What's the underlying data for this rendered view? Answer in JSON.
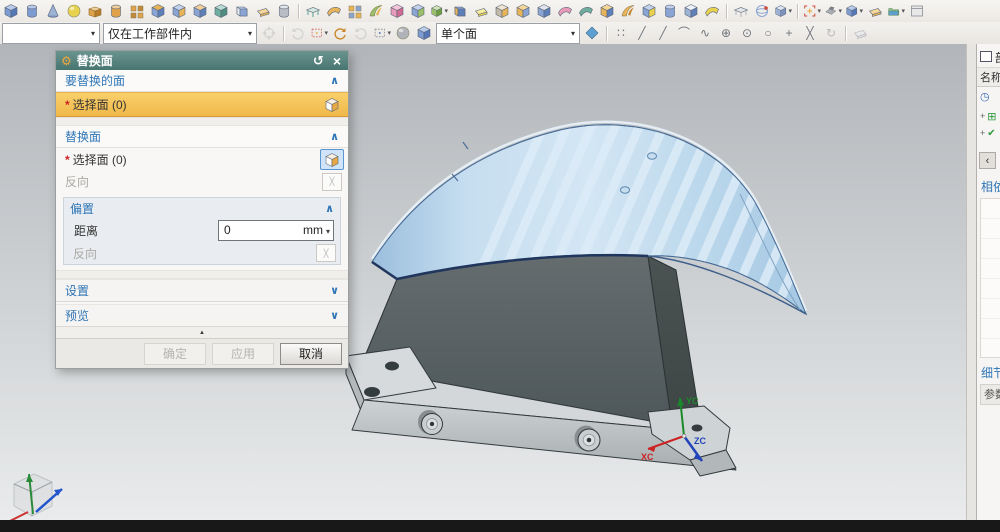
{
  "selection_bar": {
    "type_filter_value": "",
    "scope_value": "仅在工作部件内",
    "face_rule_value": "单个面"
  },
  "dialog": {
    "title": "替换面",
    "sections": {
      "faces_to_replace": "要替换的面",
      "replacement_face": "替换面",
      "offset": "偏置",
      "settings": "设置",
      "preview": "预览"
    },
    "rows": {
      "target_select": {
        "asterisk": "*",
        "label": "选择面 (0)"
      },
      "replacement_select": {
        "asterisk": "*",
        "label": "选择面 (0)"
      },
      "reverse_replacement": "反向",
      "distance_label": "距离",
      "distance_value": "0",
      "distance_unit": "mm",
      "reverse_offset": "反向"
    },
    "buttons": {
      "ok": "确定",
      "apply": "应用",
      "cancel": "取消"
    }
  },
  "part_navigator": {
    "tab_title": "部",
    "column_header": "名称",
    "sections": {
      "dependencies": "相依",
      "details": "细节",
      "details_column": "参数"
    }
  },
  "viewport": {
    "wcs_labels": {
      "xc": "XC",
      "yc": "YC",
      "zc": "ZC"
    }
  },
  "colors": {
    "dialog_header": "#4e7f7a",
    "highlight_row": "#f5c45c",
    "accent_blue": "#2e75b6",
    "sheet_blue": "#c6def0",
    "block_gray": "#596164",
    "viewport_top": "#b2b6ba",
    "viewport_bottom": "#e9ebec"
  },
  "toolbar_row1": [
    {
      "n": "block-icon",
      "g": "cube",
      "c": [
        "#7d9bd0",
        "#5577b5",
        "#b9cbe8"
      ]
    },
    {
      "n": "cylinder-icon",
      "g": "cyl",
      "c": [
        "#7d9bd0",
        "#5577b5",
        "#b9cbe8"
      ]
    },
    {
      "n": "cone-icon",
      "g": "cone",
      "c": [
        "#9db3d6",
        "#7d93bd",
        "#cdd9ec"
      ]
    },
    {
      "n": "sphere-icon",
      "g": "sphere",
      "c": [
        "#e8d24e",
        "#c9ae2e",
        "#f6eca0"
      ]
    },
    {
      "n": "shell-icon",
      "g": "openbox",
      "c": [
        "#e0a24a",
        "#b97c2a",
        "#f0cf9a"
      ]
    },
    {
      "n": "boss-icon",
      "g": "cyl",
      "c": [
        "#e0a24a",
        "#b97c2a",
        "#f0cf9a"
      ]
    },
    {
      "n": "emboss-icon",
      "g": "grid",
      "c": [
        "#e0a24a",
        "#c08a3a",
        "#f0cf9a"
      ]
    },
    {
      "n": "pocket-icon",
      "g": "cube",
      "c": [
        "#8aa5d4",
        "#5f7fb8",
        "#e8b45a"
      ]
    },
    {
      "n": "pad-feature-icon",
      "g": "cube",
      "c": [
        "#8aa5d4",
        "#e8b45a",
        "#c3d2ec"
      ]
    },
    {
      "n": "hole-icon",
      "g": "cube",
      "c": [
        "#8aa5d4",
        "#5f7fb8",
        "#f0cf9a"
      ]
    },
    {
      "n": "rib-icon",
      "g": "cube",
      "c": [
        "#6fae9e",
        "#4f8e7e",
        "#b9dcd2"
      ]
    },
    {
      "n": "datum-plane-icon",
      "g": "book",
      "c": [
        "#b9cbe8",
        "#8aa5d4",
        "#e6edf8"
      ]
    },
    {
      "n": "sketch-icon",
      "g": "pad",
      "c": [
        "#e8b45a",
        "#c08a3a",
        "#f6d79a"
      ]
    },
    {
      "n": "thread-icon",
      "g": "cyl",
      "c": [
        "#b9bec6",
        "#8f959e",
        "#e2e5ea"
      ]
    },
    {
      "sep": 1
    },
    {
      "n": "extrude-icon",
      "g": "bench",
      "c": [
        "#6fae9e",
        "#4f8e7e",
        "#d4e9e3"
      ]
    },
    {
      "n": "bounded-plane-icon",
      "g": "sheet",
      "c": [
        "#e8b45a",
        "#c08a3a",
        "#f6d79a"
      ]
    },
    {
      "n": "pattern-feature-icon",
      "g": "grid",
      "c": [
        "#e8b45a",
        "#8aa5d4",
        "#f6d79a"
      ]
    },
    {
      "n": "sweep-icon",
      "g": "swoosh",
      "c": [
        "#9cc06a",
        "#e8b45a"
      ]
    },
    {
      "n": "delete-face-icon",
      "g": "cube",
      "c": [
        "#e89ab8",
        "#d06a90",
        "#f4c6d8"
      ]
    },
    {
      "n": "move-face-icon",
      "g": "cube",
      "c": [
        "#8aa5d4",
        "#9cc06a",
        "#c3d2ec"
      ]
    },
    {
      "n": "offset-region-icon",
      "g": "cube",
      "c": [
        "#9cc06a",
        "#6f9e3e",
        "#cfe4b4"
      ],
      "caret": 1
    },
    {
      "n": "reuse-library-icon",
      "g": "book",
      "c": [
        "#8aa5d4",
        "#5f7fb8",
        "#e8b45a"
      ]
    },
    {
      "n": "pull-face-icon",
      "g": "pad",
      "c": [
        "#e8d24e",
        "#c9ae2e",
        "#f6eca0"
      ]
    },
    {
      "n": "offset-face-icon",
      "g": "cube",
      "c": [
        "#c3b9a8",
        "#e8b45a",
        "#efe6d2"
      ]
    },
    {
      "n": "unite-icon",
      "g": "cube",
      "c": [
        "#e8b45a",
        "#8aa5d4",
        "#f6d79a"
      ]
    },
    {
      "n": "subtract-icon",
      "g": "cube",
      "c": [
        "#8aa5d4",
        "#5f7fb8",
        "#e2e5ea"
      ]
    },
    {
      "n": "thicken-icon",
      "g": "sheet",
      "c": [
        "#e89ab8",
        "#d06a90",
        "#f4c6d8"
      ]
    },
    {
      "n": "sew-icon",
      "g": "sheet",
      "c": [
        "#6fae9e",
        "#4f8e7e",
        "#d4e9e3"
      ]
    },
    {
      "n": "trim-body-icon",
      "g": "cube",
      "c": [
        "#e8b45a",
        "#5f7fb8",
        "#f6d79a"
      ]
    },
    {
      "n": "split-body-icon",
      "g": "swoosh",
      "c": [
        "#e8b45a",
        "#c08a3a"
      ]
    },
    {
      "n": "mirror-feature-icon",
      "g": "cube",
      "c": [
        "#8aa5d4",
        "#e8d24e",
        "#c3d2ec"
      ]
    },
    {
      "n": "pattern-geometry-icon",
      "g": "cyl",
      "c": [
        "#8aa5d4",
        "#5f7fb8",
        "#c3d2ec"
      ]
    },
    {
      "n": "assembly-cut-icon",
      "g": "cube",
      "c": [
        "#9db3d6",
        "#5f7fb8",
        "#eef2f9"
      ]
    },
    {
      "n": "emboss-sheet-icon",
      "g": "sheet",
      "c": [
        "#e8d24e",
        "#c9ae2e",
        "#f6eca0"
      ]
    },
    {
      "sep": 1
    },
    {
      "n": "datum-csys-icon",
      "g": "bench",
      "c": [
        "#b9bec6",
        "#8f959e",
        "#e2e5ea"
      ]
    },
    {
      "n": "measure-icon",
      "g": "orbit",
      "c": [
        "#8aa5d4",
        "#d04a3a"
      ]
    },
    {
      "n": "view-orient-icon",
      "g": "cube",
      "c": [
        "#9db3d6",
        "#7d93bd",
        "#dbe4f2"
      ],
      "caret": 1
    },
    {
      "sep": 1
    },
    {
      "n": "fit-view-icon",
      "g": "fit",
      "c": [
        "#d04a3a",
        "#e8a43a"
      ],
      "caret": 1
    },
    {
      "n": "render-style-icon",
      "g": "clamp",
      "c": [
        "#a8adb4",
        "#7d838c"
      ],
      "caret": 1
    },
    {
      "n": "shaded-cube-icon",
      "g": "cube",
      "c": [
        "#7d9bd0",
        "#5577b5",
        "#b9cbe8"
      ],
      "caret": 1
    },
    {
      "n": "background-icon",
      "g": "pad",
      "c": [
        "#e8b45a",
        "#c08a3a",
        "#f6d79a"
      ]
    },
    {
      "n": "snapshot-folder-icon",
      "g": "folder",
      "c": [
        "#8fbf8a",
        "#5f9fd0"
      ],
      "caret": 1
    },
    {
      "n": "new-window-icon",
      "g": "window",
      "c": [
        "#e8e8e8",
        "#9aa0a6"
      ]
    }
  ],
  "selection_icons_a": [
    {
      "n": "selection-filter-icon",
      "g": "target",
      "c": [
        "#9aa0a6"
      ],
      "faded": 1
    },
    {
      "sep": 1
    },
    {
      "n": "previous-selection-icon",
      "g": "arrowccw",
      "c": [
        "#b0b4ba"
      ],
      "faded": 1
    },
    {
      "n": "capture-region-icon",
      "g": "marquee",
      "c": [
        "#d06a5a",
        "#e8b45a"
      ],
      "caret": 1
    },
    {
      "n": "redo-selection-icon",
      "g": "arrowcw",
      "c": [
        "#c9882a"
      ]
    },
    {
      "n": "undo-selection-icon",
      "g": "arrowccw",
      "c": [
        "#b0b4ba"
      ],
      "faded": 1
    },
    {
      "n": "rectangle-select-icon",
      "g": "marquee",
      "c": [
        "#8a9098"
      ],
      "caret": 1
    },
    {
      "n": "highlight-body-icon",
      "g": "sphere",
      "c": [
        "#b0b4ba",
        "#888888",
        "#dddddd"
      ]
    },
    {
      "n": "solid-select-icon",
      "g": "cube",
      "c": [
        "#7d9bd0",
        "#5577b5",
        "#b9cbe8"
      ]
    }
  ],
  "selection_icons_b": [
    {
      "n": "direction-toggle-icon",
      "g": "diamond",
      "c": [
        "#5f9fd0"
      ]
    },
    {
      "sep": 1
    },
    {
      "n": "snap-point-toggle-icon",
      "t": "∷"
    },
    {
      "n": "endpoint-snap-icon",
      "t": "╱"
    },
    {
      "n": "midpoint-snap-icon",
      "t": "╱"
    },
    {
      "n": "control-point-snap-icon",
      "t": "⌒"
    },
    {
      "n": "pole-snap-icon",
      "t": "∿"
    },
    {
      "n": "quadrant-snap-icon",
      "t": "⊕"
    },
    {
      "n": "arc-center-snap-icon",
      "t": "⊙"
    },
    {
      "n": "circle-center-snap-icon",
      "t": "○"
    },
    {
      "n": "point-snap-icon",
      "t": "+"
    },
    {
      "n": "intersection-snap-icon",
      "t": "╳"
    },
    {
      "n": "rotate-point-icon",
      "t": "↻",
      "faded": 1
    },
    {
      "sep": 1
    },
    {
      "n": "plane-tool-icon",
      "g": "pad",
      "c": [
        "#c9ccd2",
        "#aab0b6",
        "#e8eaee"
      ],
      "faded": 1
    }
  ]
}
